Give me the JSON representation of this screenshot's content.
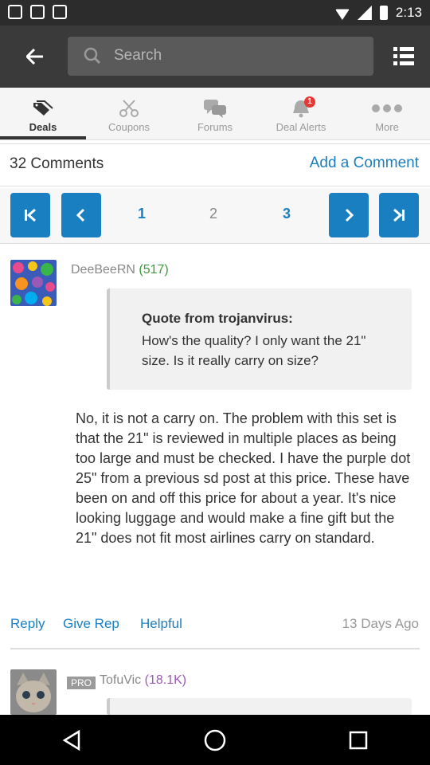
{
  "status_bar": {
    "time": "2:13"
  },
  "top_bar": {
    "search_placeholder": "Search"
  },
  "tabs": [
    {
      "label": "Deals",
      "icon": "tag-icon",
      "active": true
    },
    {
      "label": "Coupons",
      "icon": "scissors-icon",
      "active": false
    },
    {
      "label": "Forums",
      "icon": "chat-bubbles-icon",
      "active": false
    },
    {
      "label": "Deal Alerts",
      "icon": "alert-bell-icon",
      "active": false,
      "badge": "1"
    },
    {
      "label": "More",
      "icon": "more-dots-icon",
      "active": false
    }
  ],
  "comments_header": {
    "count_label": "32 Comments",
    "add_comment": "Add a Comment"
  },
  "pager": {
    "pages": [
      "1",
      "2",
      "3"
    ],
    "current": "1"
  },
  "comment1": {
    "username": "DeeBeeRN",
    "rep": "(517)",
    "quote_from": "Quote from trojanvirus:",
    "quote_text": "How's the quality? I only want the 21\" size. Is it really carry on size?",
    "body": "No, it is not a carry on. The problem with this set is that the 21\" is reviewed in multiple places as being too large and must be checked. I have the purple dot 25\" from a previous sd post at this price. These have been on and off this price for about a year. It's nice looking luggage and would make a fine gift but the 21\" does not fit most airlines carry on standard.",
    "actions": {
      "reply": "Reply",
      "give_rep": "Give Rep",
      "helpful": "Helpful"
    },
    "time": "13 Days Ago"
  },
  "comment2": {
    "pro_label": "PRO",
    "username": "TofuVic",
    "rep": "(18.1K)"
  },
  "colors": {
    "accent": "#1a7fc1",
    "topbar": "#3a3a3a",
    "rep_green": "#3a9a3a",
    "rep_purple": "#9b59b6"
  }
}
